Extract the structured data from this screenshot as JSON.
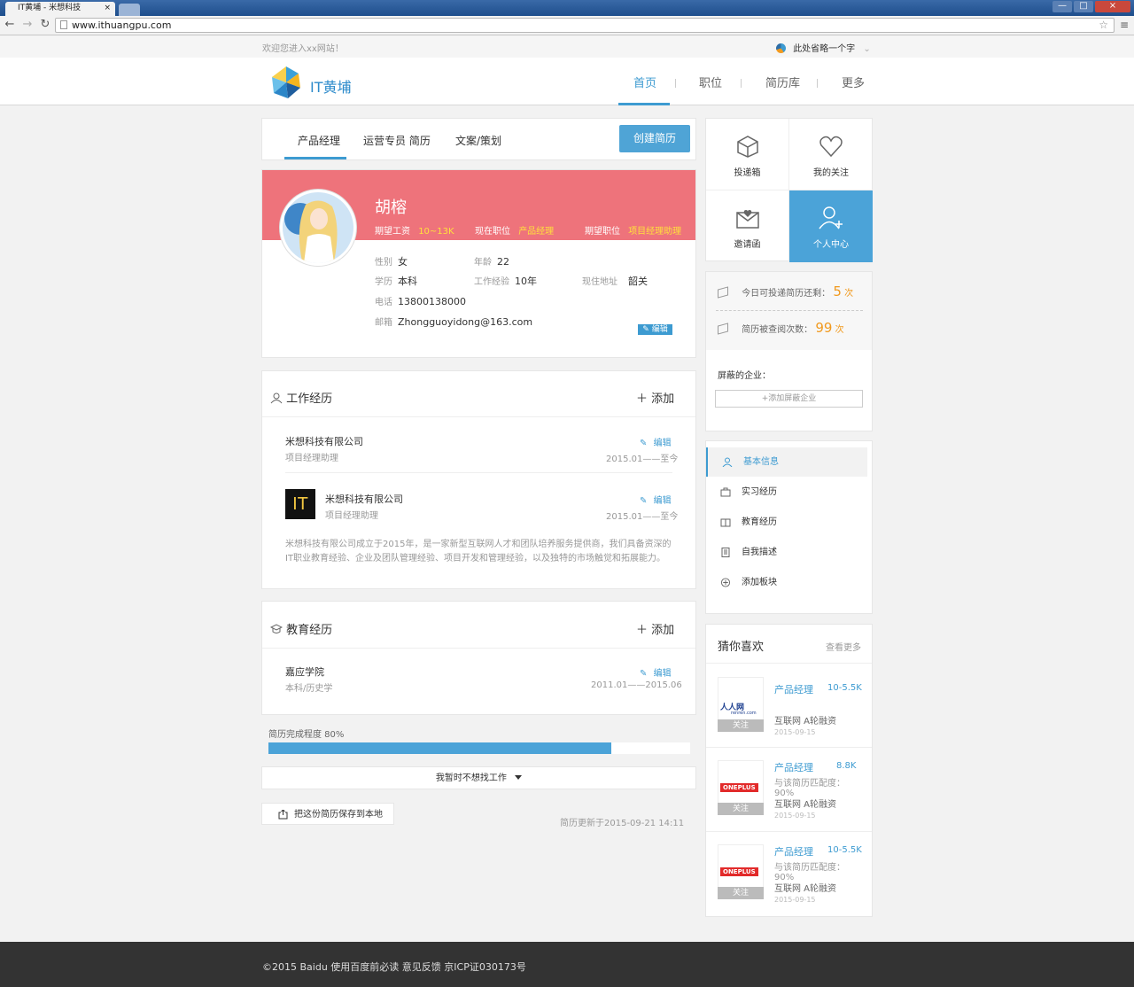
{
  "browser": {
    "tab_title": "IT黄埔 - 米想科技",
    "tab_close": "×",
    "url": "www.ithuangpu.com",
    "win_min": "—",
    "win_max": "□",
    "win_close": "×"
  },
  "topbar": {
    "welcome": "欢迎您进入xx网站！",
    "right_text": "此处省略一个字"
  },
  "header": {
    "logo_text": "IT黄埔",
    "nav": [
      "首页",
      "职位",
      "简历库",
      "更多"
    ],
    "active_nav": "首页"
  },
  "resume_tabs": {
    "tabs": [
      "产品经理",
      "运营专员  简历",
      "文案/策划"
    ],
    "create_button": "创建简历"
  },
  "profile": {
    "name": "胡榕",
    "expected_salary_label": "期望工资",
    "expected_salary": "10~13K",
    "current_position_label": "现在职位",
    "current_position": "产品经理",
    "expected_position_label": "期望职位",
    "expected_position": "项目经理助理",
    "gender_label": "性别",
    "gender": "女",
    "age_label": "年龄",
    "age": "22",
    "education_label": "学历",
    "education": "本科",
    "experience_label": "工作经验",
    "experience": "10年",
    "address_label": "现住地址",
    "address": "韶关",
    "phone_label": "电话",
    "phone": "13800138000",
    "email_label": "邮箱",
    "email": "Zhongguoyidong@163.com",
    "edit_label": "编辑"
  },
  "work": {
    "title": "工作经历",
    "add_label": "添加",
    "entries": [
      {
        "company": "米想科技有限公司",
        "role": "项目经理助理",
        "edit": "编辑",
        "date": "2015.01——至今"
      },
      {
        "company": "米想科技有限公司",
        "role": "项目经理助理",
        "edit": "编辑",
        "date": "2015.01——至今",
        "logo_text": "IT"
      }
    ],
    "description": "米想科技有限公司成立于2015年，是一家新型互联网人才和团队培养服务提供商，我们具备资深的IT职业教育经验、企业及团队管理经验、项目开发和管理经验，以及独特的市场触觉和拓展能力。"
  },
  "education": {
    "title": "教育经历",
    "add_label": "添加",
    "school": "嘉应学院",
    "major": "本科/历史学",
    "edit": "编辑",
    "date": "2011.01——2015.06"
  },
  "completion": {
    "label": "简历完成程度 80%",
    "percent": 80
  },
  "job_status": "我暂时不想找工作",
  "save_local": "把这份简历保存到本地",
  "updated": "简历更新于2015-09-21 14:11",
  "quick_links": [
    {
      "label": "投递箱",
      "icon": "inbox-icon"
    },
    {
      "label": "我的关注",
      "icon": "heart-icon"
    },
    {
      "label": "邀请函",
      "icon": "invitation-icon"
    },
    {
      "label": "个人中心",
      "icon": "user-add-icon"
    }
  ],
  "stats": {
    "today_label": "今日可投递简历还剩：",
    "today_num": "5",
    "today_unit": "次",
    "viewed_label": "简历被查阅次数：",
    "viewed_num": "99",
    "viewed_unit": "次",
    "blocked_label": "屏蔽的企业：",
    "blocked_button": "+添加屏蔽企业"
  },
  "side_menu": [
    "基本信息",
    "实习经历",
    "教育经历",
    "自我描述",
    "添加板块"
  ],
  "guess": {
    "title": "猜你喜欢",
    "more": "查看更多",
    "items": [
      {
        "logo": "人人网",
        "logo_sub": "renren.com",
        "title": "产品经理",
        "salary": "10-5.5K",
        "match": "",
        "tags": "互联网    A轮融资",
        "date": "2015-09-15",
        "follow": "关注"
      },
      {
        "logo": "ONEPLUS",
        "logo_sub": "",
        "title": "产品经理",
        "salary": "8.8K",
        "match": "与该简历匹配度：90%",
        "tags": "互联网    A轮融资",
        "date": "2015-09-15",
        "follow": "关注"
      },
      {
        "logo": "ONEPLUS",
        "logo_sub": "",
        "title": "产品经理",
        "salary": "10-5.5K",
        "match": "与该简历匹配度：90%",
        "tags": "互联网    A轮融资",
        "date": "2015-09-15",
        "follow": "关注"
      }
    ]
  },
  "footer": "©2015 Baidu 使用百度前必读 意见反馈 京ICP证030173号",
  "colors": {
    "accent": "#3d9bd1",
    "band": "#ee737b",
    "highlight": "#ffe03c",
    "orange": "#f19a1f"
  }
}
